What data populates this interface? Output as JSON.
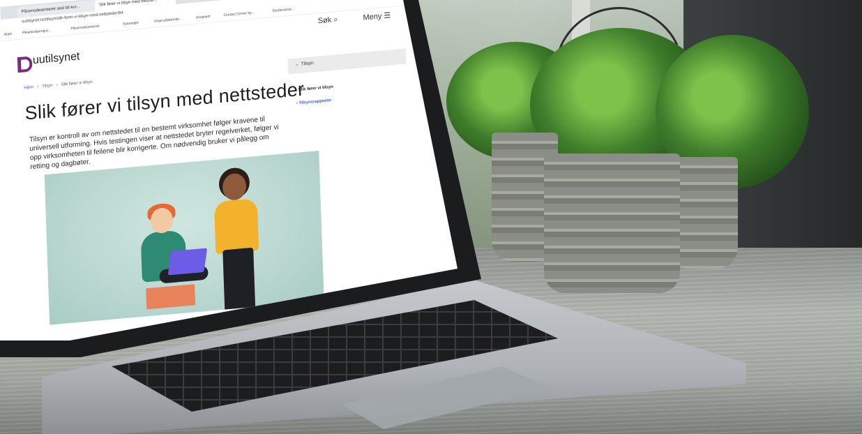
{
  "browser": {
    "tabs": [
      {
        "label": "Påramodesenteret skal bli kor..."
      },
      {
        "label": "Slik fører vi tilsyn med nettste..."
      }
    ],
    "new_tab": "+",
    "url": "uutilsynet.no/tilsyn/slik-forer-vi-tilsyn-med-nettsteder/84",
    "bookmarks": [
      "Apps",
      "Påramodsprogra...",
      "Påramodesenteret",
      "Stavanger",
      "Unge pårørende",
      "Unsplash",
      "Contact Center by...",
      "Shutterstock"
    ]
  },
  "site": {
    "logo_text": "uutilsynet",
    "search_label": "Søk",
    "menu_label": "Meny",
    "breadcrumb": [
      "Hjem",
      "Tilsyn",
      "Slik fører vi tilsyn"
    ],
    "title": "Slik fører vi tilsyn med nettsteder",
    "intro": "Tilsyn er kontroll av om nettstedet til en bestemt virksomhet følger kravene til universell utforming. Hvis testingen viser at nettstedet bryter regelverket, følger vi opp virksomheten til feilene blir korrigerte. Om nødvendig bruker vi pålegg om retting og dagbøter.",
    "sidebar": {
      "back_label": "Tilsyn",
      "items": [
        "Slik fører vi tilsyn",
        "Tilsynsrapporter"
      ]
    }
  },
  "colors": {
    "brand": "#7b2a86",
    "link": "#3b5bdb"
  }
}
